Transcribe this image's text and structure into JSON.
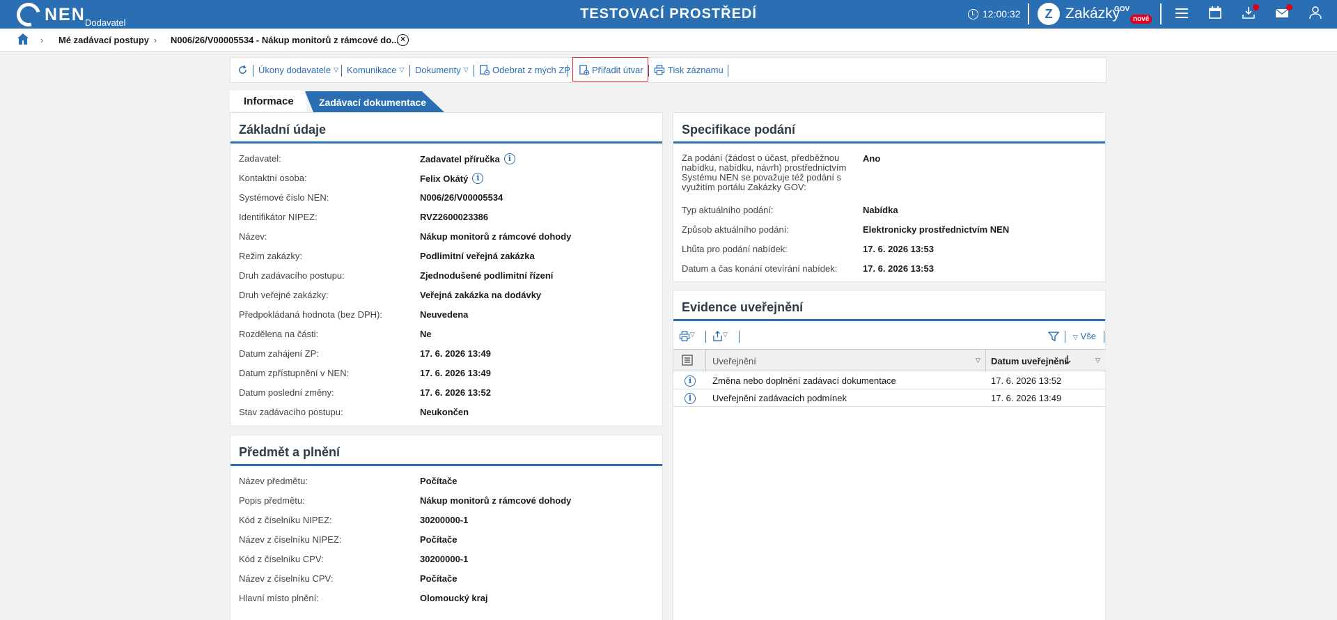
{
  "header": {
    "logo_text": "NEN",
    "logo_sub": "Dodavatel",
    "env_title": "TESTOVACÍ PROSTŘEDÍ",
    "time": "12:00:32",
    "gov_logo": "Z",
    "gov_text": "Zakázky",
    "gov_sup": "GOV",
    "gov_badge": "nové",
    "icons": [
      "menu-icon",
      "calendar-icon",
      "download-icon",
      "mail-icon",
      "user-icon"
    ]
  },
  "breadcrumb": {
    "item1": "Mé zadávací postupy",
    "item2": "N006/26/V00005534 - Nákup monitorů z rámcové do..."
  },
  "toolbar": {
    "ukony": "Úkony dodavatele",
    "komunikace": "Komunikace",
    "dokumenty": "Dokumenty",
    "odebrat": "Odebrat z mých ZP",
    "priradit": "Přiřadit útvar",
    "tisk": "Tisk záznamu"
  },
  "tabs": {
    "active": "Informace",
    "inactive": "Zadávací dokumentace"
  },
  "zakladni": {
    "title": "Základní údaje",
    "rows": [
      {
        "label": "Zadavatel:",
        "value": "Zadavatel příručka",
        "info": true
      },
      {
        "label": "Kontaktní osoba:",
        "value": "Felix Okátý",
        "info": true
      },
      {
        "label": "Systémové číslo NEN:",
        "value": "N006/26/V00005534"
      },
      {
        "label": "Identifikátor NIPEZ:",
        "value": "RVZ2600023386"
      },
      {
        "label": "Název:",
        "value": "Nákup monitorů z rámcové dohody"
      },
      {
        "label": "Režim zakázky:",
        "value": "Podlimitní veřejná zakázka"
      },
      {
        "label": "Druh zadávacího postupu:",
        "value": "Zjednodušené podlimitní řízení"
      },
      {
        "label": "Druh veřejné zakázky:",
        "value": "Veřejná zakázka na dodávky"
      },
      {
        "label": "Předpokládaná hodnota (bez DPH):",
        "value": "Neuvedena"
      },
      {
        "label": "Rozdělena na části:",
        "value": "Ne"
      },
      {
        "label": "Datum zahájení ZP:",
        "value": "17. 6. 2026 13:49"
      },
      {
        "label": "Datum zpřístupnění v NEN:",
        "value": "17. 6. 2026 13:49"
      },
      {
        "label": "Datum poslední změny:",
        "value": "17. 6. 2026 13:52"
      },
      {
        "label": "Stav zadávacího postupu:",
        "value": "Neukončen"
      }
    ]
  },
  "predmet": {
    "title": "Předmět a plnění",
    "rows": [
      {
        "label": "Název předmětu:",
        "value": "Počítače"
      },
      {
        "label": "Popis předmětu:",
        "value": "Nákup monitorů z rámcové dohody"
      },
      {
        "label": "Kód z číselníku NIPEZ:",
        "value": "30200000-1"
      },
      {
        "label": "Název z číselníku NIPEZ:",
        "value": "Počítače"
      },
      {
        "label": "Kód z číselníku CPV:",
        "value": "30200000-1"
      },
      {
        "label": "Název z číselníku CPV:",
        "value": "Počítače"
      },
      {
        "label": "Hlavní místo plnění:",
        "value": "Olomoucký kraj"
      }
    ]
  },
  "specifikace": {
    "title": "Specifikace podání",
    "rows": [
      {
        "label": "Za podání (žádost o účast, předběžnou nabídku, nabídku, návrh) prostřednictvím Systému NEN se považuje též podání s využitím portálu Zakázky GOV:",
        "value": "Ano"
      },
      {
        "label": "Typ aktuálního podání:",
        "value": "Nabídka"
      },
      {
        "label": "Způsob aktuálního podání:",
        "value": "Elektronicky prostřednictvím NEN"
      },
      {
        "label": "Lhůta pro podání nabídek:",
        "value": "17. 6. 2026 13:53"
      },
      {
        "label": "Datum a čas konání otevírání nabídek:",
        "value": "17. 6. 2026 13:53"
      }
    ]
  },
  "evidence": {
    "title": "Evidence uveřejnění",
    "filter_all": "Vše",
    "col_uverejneni": "Uveřejnění",
    "col_datum": "Datum uveřejnění",
    "rows": [
      {
        "name": "Změna nebo doplnění zadávací dokumentace",
        "date": "17. 6. 2026 13:52"
      },
      {
        "name": "Uveřejnění zadávacích podmínek",
        "date": "17. 6. 2026 13:49"
      }
    ]
  }
}
